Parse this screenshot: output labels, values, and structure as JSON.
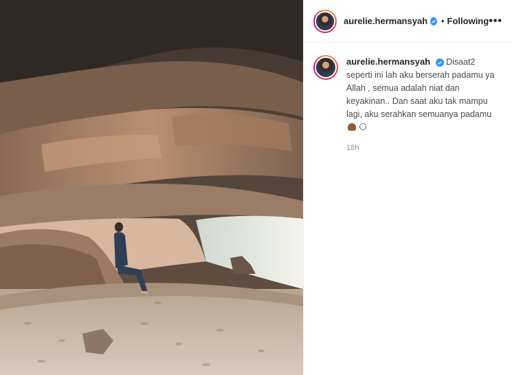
{
  "post": {
    "image_alt_semantic": "cave-beach-photo",
    "header": {
      "username": "aurelie.hermansyah",
      "separator": "•",
      "follow_status": "Following",
      "more_label": "•••"
    },
    "caption": {
      "username": "aurelie.hermansyah",
      "text_line1": "Disaat2 seperti ini lah aku berserah padamu ya Allah , semua adalah niat dan keyakinan.. Dan saat aku tak mampu lagi, aku serahkan semuanya padamu",
      "emojis": [
        "pray-icon",
        "copyright-icon"
      ]
    },
    "timestamp": "18h"
  },
  "colors": {
    "verified_blue": "#3897f0",
    "text_primary": "#262626",
    "text_muted": "#8e8e8e"
  }
}
